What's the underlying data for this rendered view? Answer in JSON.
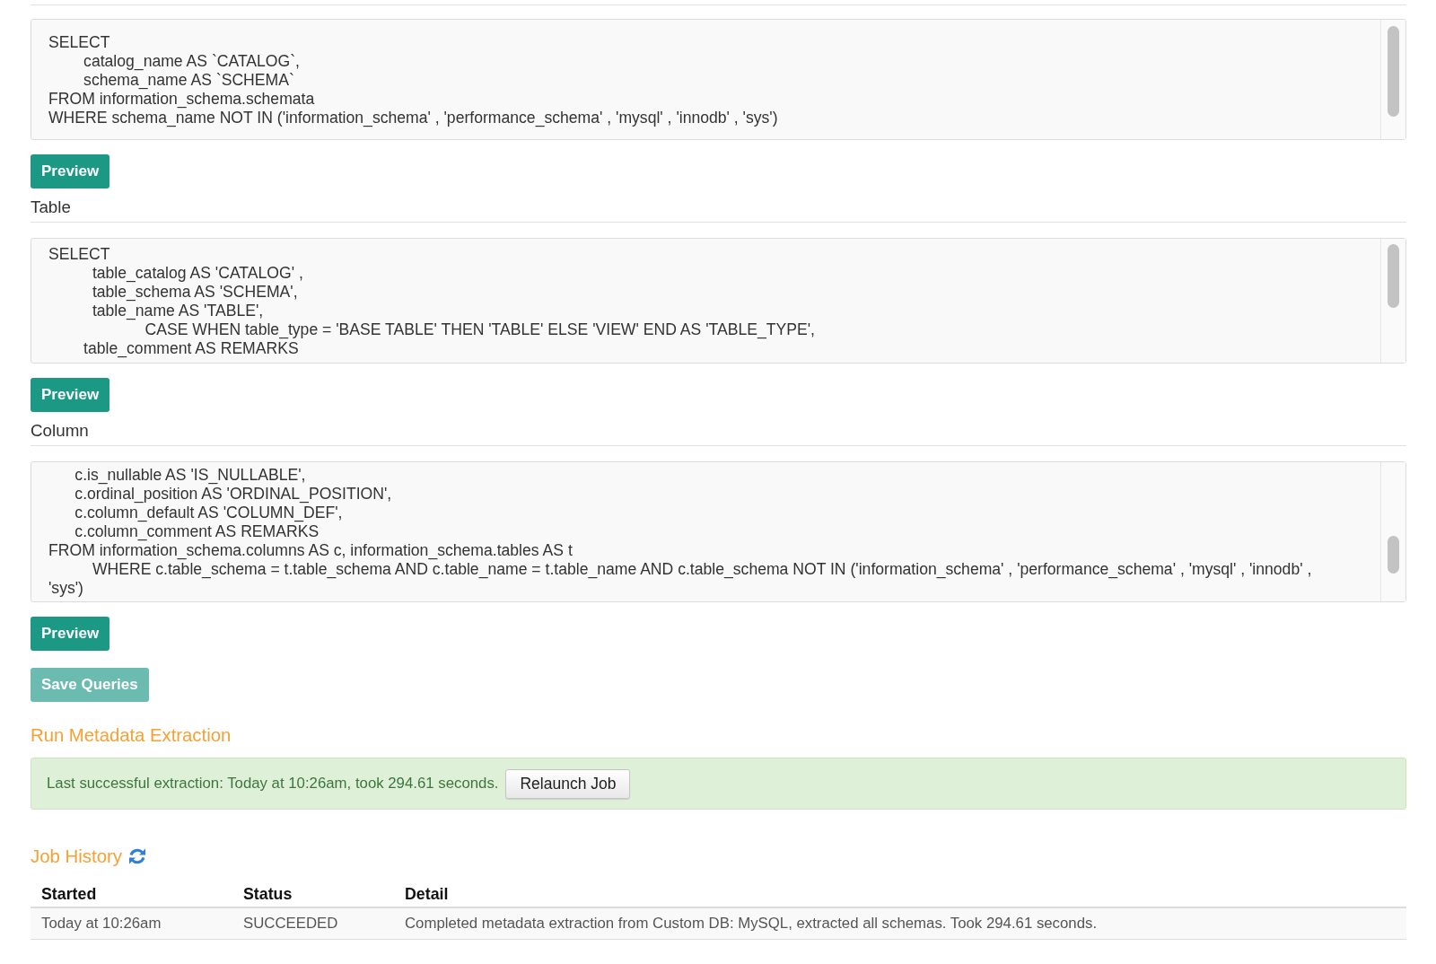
{
  "query_sections": [
    {
      "lines": [
        "SELECT",
        "        catalog_name AS `CATALOG`,",
        "        schema_name AS `SCHEMA`",
        "FROM information_schema.schemata",
        "WHERE schema_name NOT IN ('information_schema' , 'performance_schema' , 'mysql' , 'innodb' , 'sys')"
      ],
      "button": "Preview"
    },
    {
      "heading": "Table",
      "lines": [
        "SELECT",
        "          table_catalog AS 'CATALOG' ,",
        "          table_schema AS 'SCHEMA',",
        "          table_name AS 'TABLE',",
        "                      CASE WHEN table_type = 'BASE TABLE' THEN 'TABLE' ELSE 'VIEW' END AS 'TABLE_TYPE',",
        "        table_comment AS REMARKS"
      ],
      "button": "Preview"
    },
    {
      "heading": "Column",
      "lines": [
        "      c.is_nullable AS 'IS_NULLABLE',",
        "      c.ordinal_position AS 'ORDINAL_POSITION',",
        "      c.column_default AS 'COLUMN_DEF',",
        "      c.column_comment AS REMARKS",
        "FROM information_schema.columns AS c, information_schema.tables AS t",
        "          WHERE c.table_schema = t.table_schema AND c.table_name = t.table_name AND c.table_schema NOT IN ('information_schema' , 'performance_schema' , 'mysql' , 'innodb' , 'sys')"
      ],
      "button": "Preview"
    }
  ],
  "save_button": {
    "label": "Save Queries",
    "disabled": true
  },
  "extraction": {
    "title": "Run Metadata Extraction",
    "message": "Last successful extraction: Today at 10:26am, took 294.61 seconds.",
    "button": "Relaunch Job"
  },
  "job_history": {
    "title": "Job History",
    "columns": [
      "Started",
      "Status",
      "Detail"
    ],
    "rows": [
      [
        "Today at 10:26am",
        "SUCCEEDED",
        "Completed metadata extraction from Custom DB: MySQL, extracted all schemas. Took 294.61 seconds."
      ]
    ]
  }
}
